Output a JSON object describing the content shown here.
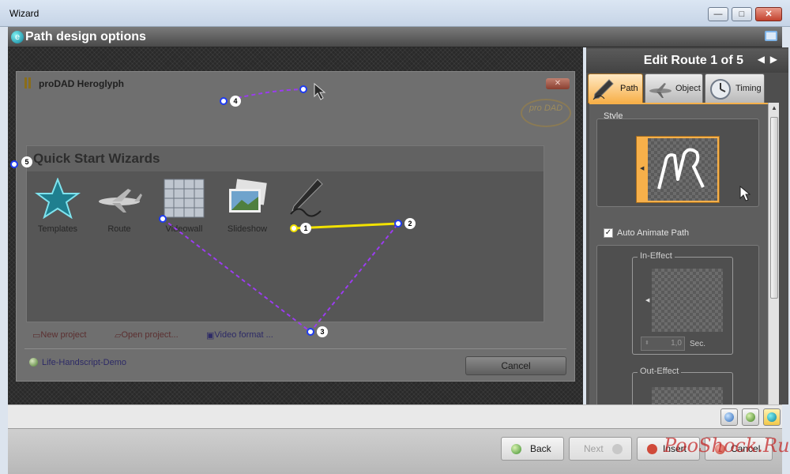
{
  "window": {
    "title": "Wizard",
    "min": "—",
    "max": "□",
    "close": "✕"
  },
  "header": {
    "title": "Path design options"
  },
  "inner_window": {
    "title": "proDAD Heroglyph",
    "close": "✕",
    "logo_text": "pro DAD",
    "quick_start_title": "Quick Start Wizards",
    "wizards": [
      {
        "label": "Templates",
        "icon": "star-icon"
      },
      {
        "label": "Route",
        "icon": "airplane-icon"
      },
      {
        "label": "Videowall",
        "icon": "grid-icon"
      },
      {
        "label": "Slideshow",
        "icon": "photos-icon"
      },
      {
        "label": "",
        "icon": "pen-icon"
      }
    ],
    "links": [
      "New project",
      "Open project...",
      "Video format ..."
    ],
    "demo_link": "Life-Handscript-Demo",
    "cancel": "Cancel"
  },
  "path_points": [
    "1",
    "2",
    "3",
    "4",
    "5"
  ],
  "panel": {
    "edit_title": "Edit Route 1 of 5",
    "prev": "◀",
    "next": "▶",
    "tabs": [
      {
        "label": "Path",
        "icon": "pen-icon",
        "active": true
      },
      {
        "label": "Object",
        "icon": "airplane-icon",
        "active": false
      },
      {
        "label": "Timing",
        "icon": "clock-icon",
        "active": false
      }
    ],
    "style_label": "Style",
    "auto_animate_label": "Auto Animate Path",
    "auto_animate_checked": "✓",
    "in_effect_label": "In-Effect",
    "in_effect_value": "1,0",
    "in_effect_unit": "Sec.",
    "out_effect_label": "Out-Effect"
  },
  "footer": {
    "back": "Back",
    "next": "Next",
    "insert": "Insert",
    "cancel": "Cancel"
  },
  "watermark": "PooShock.Ru",
  "colors": {
    "accent": "#f7b04a",
    "path_yellow": "#f2e200",
    "path_purple": "#9b3cf0",
    "point_blue": "#1f3cf0"
  }
}
